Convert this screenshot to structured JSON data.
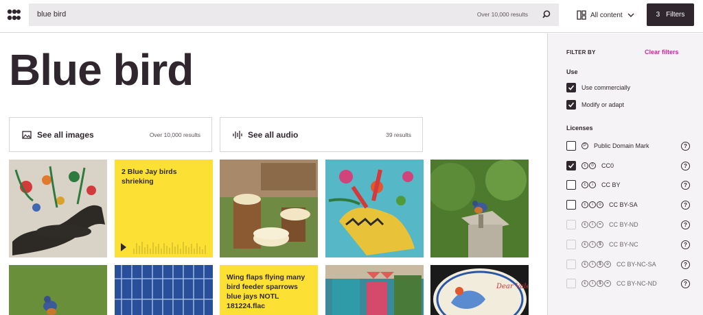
{
  "header": {
    "search_query": "blue bird",
    "search_count": "Over 10,000 results",
    "content_type": "All content",
    "filters_count": "3",
    "filters_label": "Filters"
  },
  "main": {
    "title": "Blue bird",
    "cards": [
      {
        "label": "See all images",
        "results": "Over 10,000 results",
        "icon": "image-icon"
      },
      {
        "label": "See all audio",
        "results": "39 results",
        "icon": "audio-wave-icon"
      }
    ],
    "audio_titles": [
      "2 Blue Jay birds shrieking",
      "Wing flaps flying many bird feeder sparrows blue jays NOTL 181224.flac"
    ],
    "valentine_text": "Dear Valentine"
  },
  "sidebar": {
    "filter_by": "FILTER BY",
    "clear": "Clear filters",
    "use_heading": "Use",
    "use_items": [
      {
        "label": "Use commercially",
        "checked": true
      },
      {
        "label": "Modify or adapt",
        "checked": true
      }
    ],
    "licenses_heading": "Licenses",
    "licenses": [
      {
        "label": "Public Domain Mark",
        "checked": false,
        "disabled": false
      },
      {
        "label": "CC0",
        "checked": true,
        "disabled": false
      },
      {
        "label": "CC BY",
        "checked": false,
        "disabled": false
      },
      {
        "label": "CC BY-SA",
        "checked": false,
        "disabled": false
      },
      {
        "label": "CC BY-ND",
        "checked": false,
        "disabled": true
      },
      {
        "label": "CC BY-NC",
        "checked": false,
        "disabled": true
      },
      {
        "label": "CC BY-NC-SA",
        "checked": false,
        "disabled": true
      },
      {
        "label": "CC BY-NC-ND",
        "checked": false,
        "disabled": true
      }
    ],
    "help_glyph": "?"
  },
  "colors": {
    "accent": "#c52b9b",
    "audio_tile": "#fde034",
    "dark": "#30272e"
  }
}
